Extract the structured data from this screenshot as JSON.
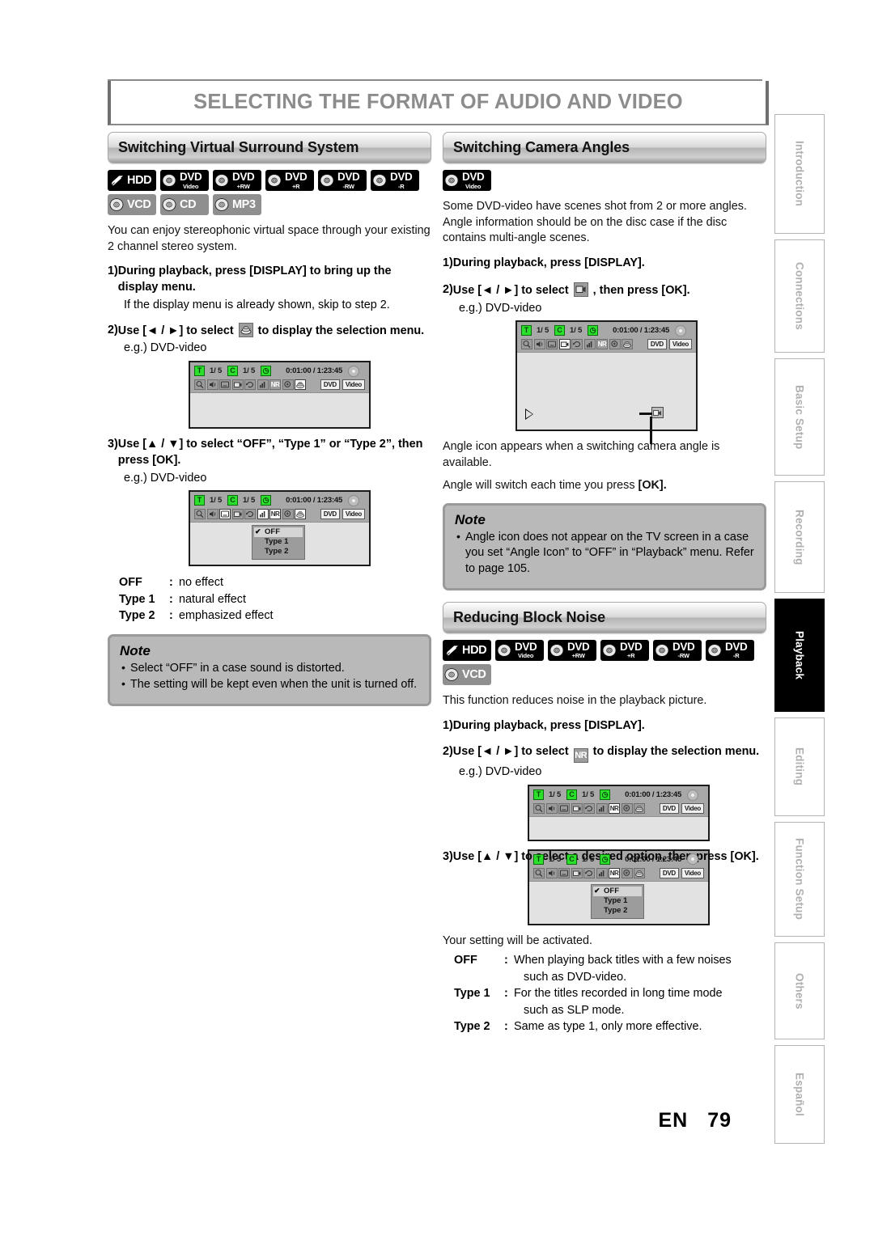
{
  "document": {
    "title": "SELECTING THE FORMAT OF AUDIO AND VIDEO",
    "page_language": "EN",
    "page_number": "79"
  },
  "sidebar": {
    "tabs": [
      {
        "label": "Introduction",
        "active": false
      },
      {
        "label": "Connections",
        "active": false
      },
      {
        "label": "Basic Setup",
        "active": false
      },
      {
        "label": "Recording",
        "active": false
      },
      {
        "label": "Playback",
        "active": true
      },
      {
        "label": "Editing",
        "active": false
      },
      {
        "label": "Function Setup",
        "active": false
      },
      {
        "label": "Others",
        "active": false
      },
      {
        "label": "Español",
        "active": false
      }
    ]
  },
  "sections": {
    "surround": {
      "heading": "Switching Virtual Surround System",
      "badges": [
        {
          "main": "HDD",
          "sub": "",
          "style": "dark",
          "icon": "hdd-icon"
        },
        {
          "main": "DVD",
          "sub": "Video",
          "style": "dark",
          "icon": "disc-icon"
        },
        {
          "main": "DVD",
          "sub": "+RW",
          "style": "dark",
          "icon": "disc-icon"
        },
        {
          "main": "DVD",
          "sub": "+R",
          "style": "dark",
          "icon": "disc-icon"
        },
        {
          "main": "DVD",
          "sub": "-RW",
          "style": "dark",
          "icon": "disc-icon"
        },
        {
          "main": "DVD",
          "sub": "-R",
          "style": "dark",
          "icon": "disc-icon"
        },
        {
          "main": "VCD",
          "sub": "",
          "style": "grey",
          "icon": "disc-icon"
        },
        {
          "main": "CD",
          "sub": "",
          "style": "grey",
          "icon": "disc-icon"
        },
        {
          "main": "MP3",
          "sub": "",
          "style": "grey",
          "icon": "disc-icon"
        }
      ],
      "intro": "You can enjoy stereophonic virtual space through your existing 2 channel stereo system.",
      "step1_num": "1)",
      "step1_text": "During playback, press [DISPLAY] to bring up the display menu.",
      "step1_sub": "If the display menu is already shown, skip to step 2.",
      "step2_num": "2)",
      "step2_a": "Use [◄ / ►] to select",
      "step2_b": "to display the selection menu.",
      "step2_eg": "e.g.) DVD-video",
      "step3_num": "3)",
      "step3_text": "Use [▲ / ▼] to select “OFF”, “Type 1” or “Type 2”, then press [OK].",
      "step3_eg": "e.g.) DVD-video",
      "definitions": [
        {
          "term": "OFF",
          "sep": ":",
          "desc": "no effect"
        },
        {
          "term": "Type 1",
          "sep": ":",
          "desc": "natural effect"
        },
        {
          "term": "Type 2",
          "sep": ":",
          "desc": "emphasized effect"
        }
      ],
      "note_title": "Note",
      "note_items": [
        "Select “OFF” in a case sound is distorted.",
        "The setting will be kept even when the unit is turned off."
      ]
    },
    "camera_angles": {
      "heading": "Switching Camera Angles",
      "badges": [
        {
          "main": "DVD",
          "sub": "Video",
          "style": "dark",
          "icon": "disc-icon"
        }
      ],
      "intro": "Some DVD-video have scenes shot from 2 or more angles. Angle information should be on the disc case if the disc contains multi-angle scenes.",
      "step1_num": "1)",
      "step1_text": "During playback, press [DISPLAY].",
      "step2_num": "2)",
      "step2_a": "Use [◄ / ►] to select",
      "step2_b": ", then press [OK].",
      "step2_eg": "e.g.) DVD-video",
      "after1": "Angle icon appears when a switching camera angle is available.",
      "after2_a": "Angle will switch each time you press",
      "after2_b": "[OK].",
      "note_title": "Note",
      "note_items": [
        "Angle icon does not appear on the TV screen in a case you set “Angle Icon” to “OFF” in “Playback” menu. Refer to page 105."
      ]
    },
    "block_noise": {
      "heading": "Reducing Block Noise",
      "badges": [
        {
          "main": "HDD",
          "sub": "",
          "style": "dark",
          "icon": "hdd-icon"
        },
        {
          "main": "DVD",
          "sub": "Video",
          "style": "dark",
          "icon": "disc-icon"
        },
        {
          "main": "DVD",
          "sub": "+RW",
          "style": "dark",
          "icon": "disc-icon"
        },
        {
          "main": "DVD",
          "sub": "+R",
          "style": "dark",
          "icon": "disc-icon"
        },
        {
          "main": "DVD",
          "sub": "-RW",
          "style": "dark",
          "icon": "disc-icon"
        },
        {
          "main": "DVD",
          "sub": "-R",
          "style": "dark",
          "icon": "disc-icon"
        },
        {
          "main": "VCD",
          "sub": "",
          "style": "grey",
          "icon": "disc-icon"
        }
      ],
      "intro": "This function reduces noise in the playback picture.",
      "step1_num": "1)",
      "step1_text": "During playback, press [DISPLAY].",
      "step2_num": "2)",
      "step2_a": "Use [◄ / ►] to select",
      "step2_chip": "NR",
      "step2_b": "to display the selection menu.",
      "step2_eg": "e.g.) DVD-video",
      "step3_num": "3)",
      "step3_text": "Use [▲ / ▼] to select a desired option, then press [OK].",
      "activated": "Your setting will be activated.",
      "definitions": [
        {
          "term": "OFF",
          "sep": ":",
          "desc": "When playing back titles with a few noises",
          "desc2": "such as DVD-video."
        },
        {
          "term": "Type 1",
          "sep": ":",
          "desc": "For the titles recorded in long time mode",
          "desc2": "such as SLP mode."
        },
        {
          "term": "Type 2",
          "sep": ":",
          "desc": "Same as type 1, only more effective.",
          "desc2": ""
        }
      ]
    }
  },
  "osd": {
    "title_box": "T",
    "title_value": "1/  5",
    "chapter_box": "C",
    "chapter_value": "1/  5",
    "clock_box": "◷",
    "time": "0:01:00 / 1:23:45",
    "tag_left": "DVD",
    "tag_right": "Video",
    "nr_label": "NR",
    "dropdown": {
      "items": [
        "OFF",
        "Type 1",
        "Type 2"
      ],
      "selected": "OFF"
    }
  }
}
